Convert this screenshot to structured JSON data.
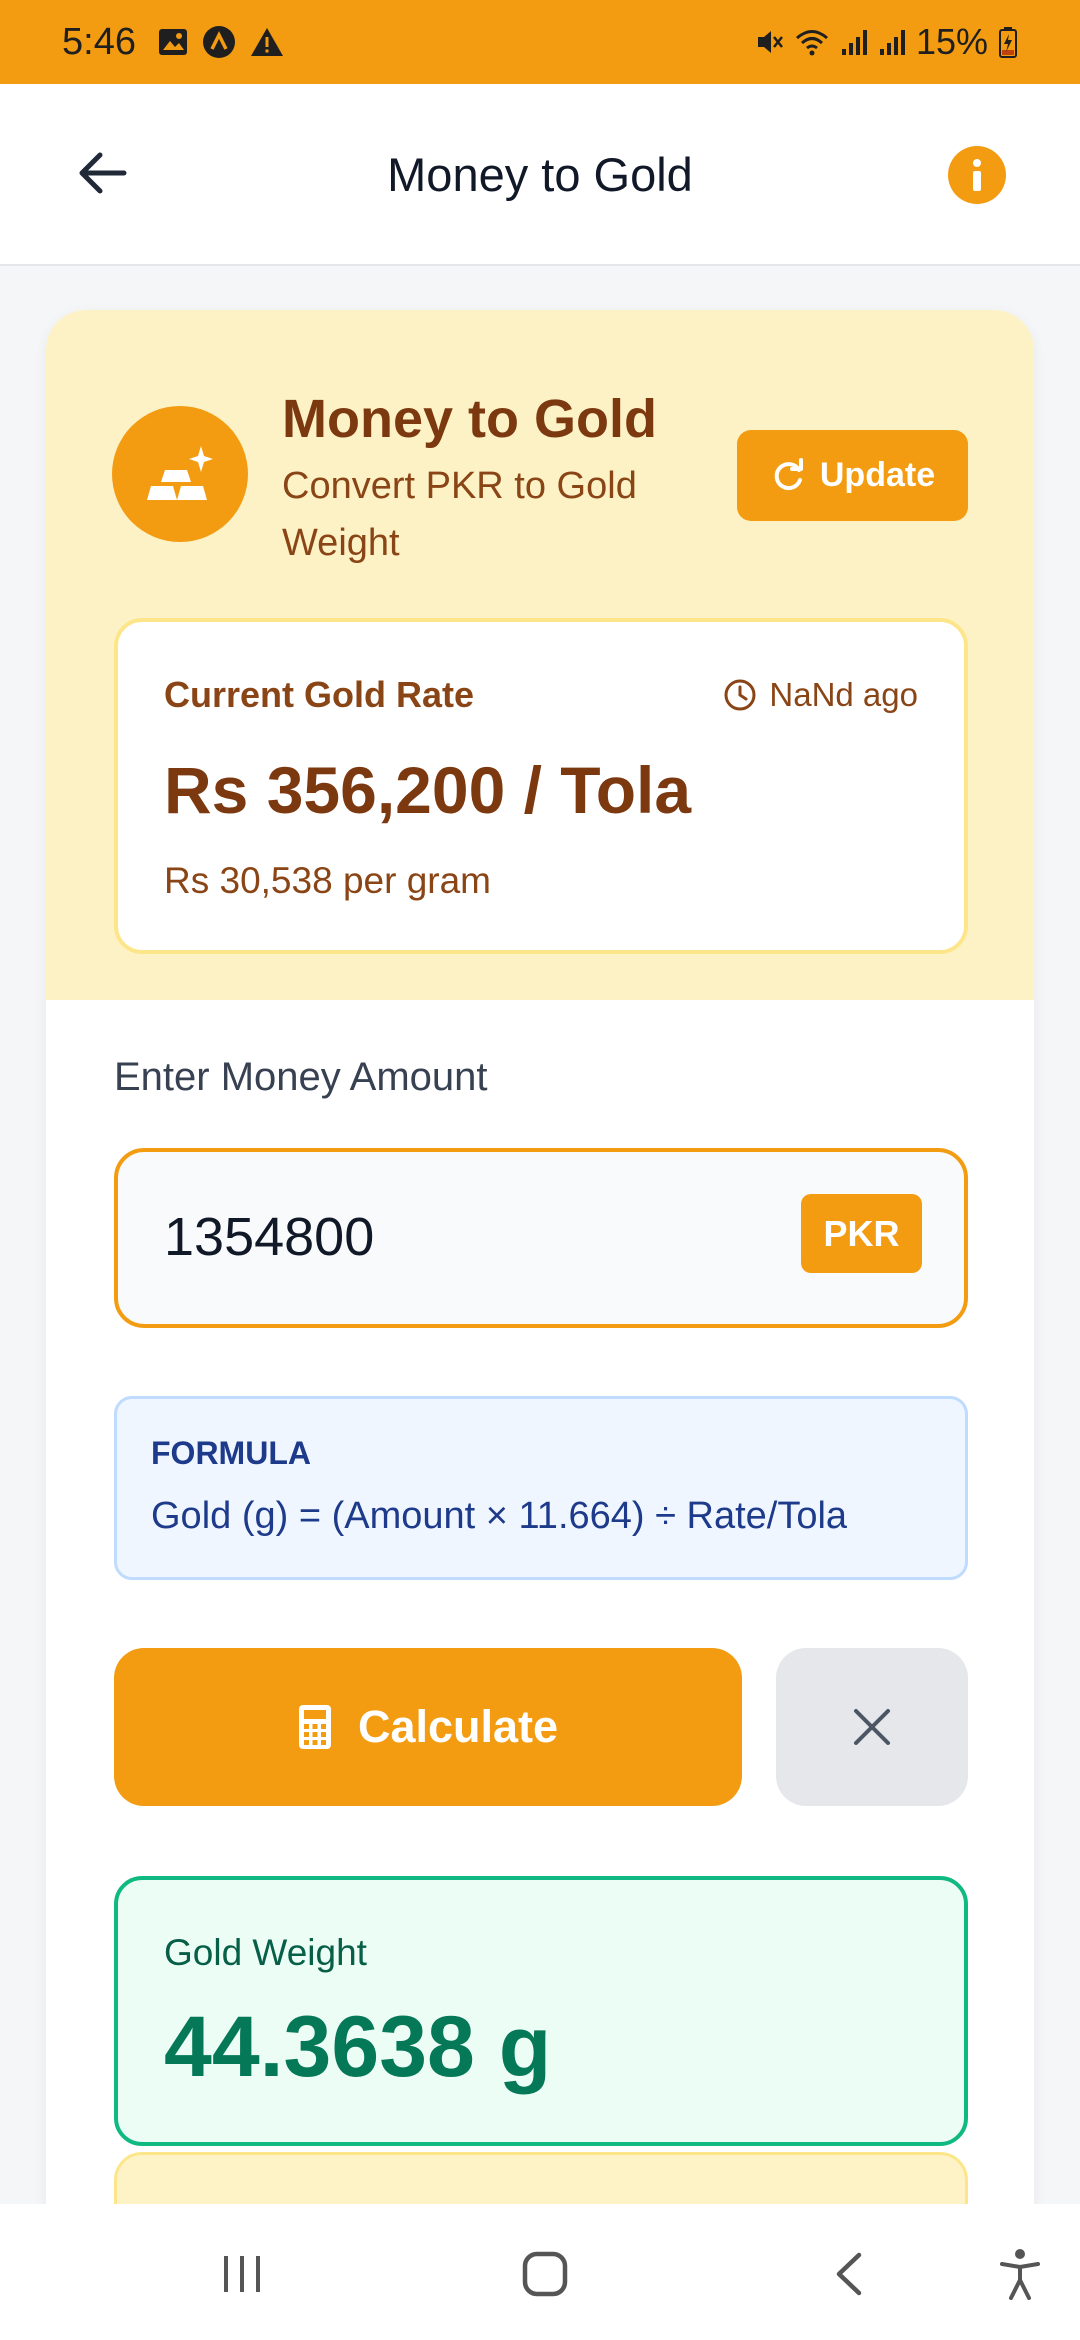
{
  "status_bar": {
    "time": "5:46",
    "battery": "15%",
    "icons": [
      "image-icon",
      "app-a-icon",
      "warning-icon",
      "mute-icon",
      "wifi-icon",
      "signal-icon",
      "signal-icon",
      "battery-charging-icon"
    ]
  },
  "app_bar": {
    "title": "Money to Gold",
    "back_icon": "arrow-left-icon",
    "info_icon": "info-icon"
  },
  "header": {
    "title": "Money to Gold",
    "subtitle": "Convert PKR to Gold Weight",
    "badge_icon": "gold-bars-icon",
    "update_label": "Update",
    "update_icon": "refresh-icon"
  },
  "rate": {
    "label": "Current Gold Rate",
    "updated": "NaNd ago",
    "value": "Rs 356,200 / Tola",
    "per_gram": "Rs 30,538 per gram"
  },
  "input": {
    "label": "Enter Money Amount",
    "value": "1354800",
    "currency": "PKR"
  },
  "formula": {
    "label": "FORMULA",
    "text": "Gold (g) = (Amount × 11.664) ÷ Rate/Tola"
  },
  "actions": {
    "calculate_label": "Calculate",
    "calculate_icon": "calculator-icon",
    "clear_icon": "close-icon"
  },
  "result": {
    "label": "Gold Weight",
    "value": "44.3638 g"
  },
  "colors": {
    "accent": "#f39c12",
    "header_bg": "#fdf2c6",
    "brown_text": "#7c3910",
    "result_green": "#047857",
    "formula_blue": "#1e3a8a"
  },
  "nav": {
    "icons": [
      "recent-apps-icon",
      "home-icon",
      "back-icon",
      "accessibility-icon"
    ]
  }
}
